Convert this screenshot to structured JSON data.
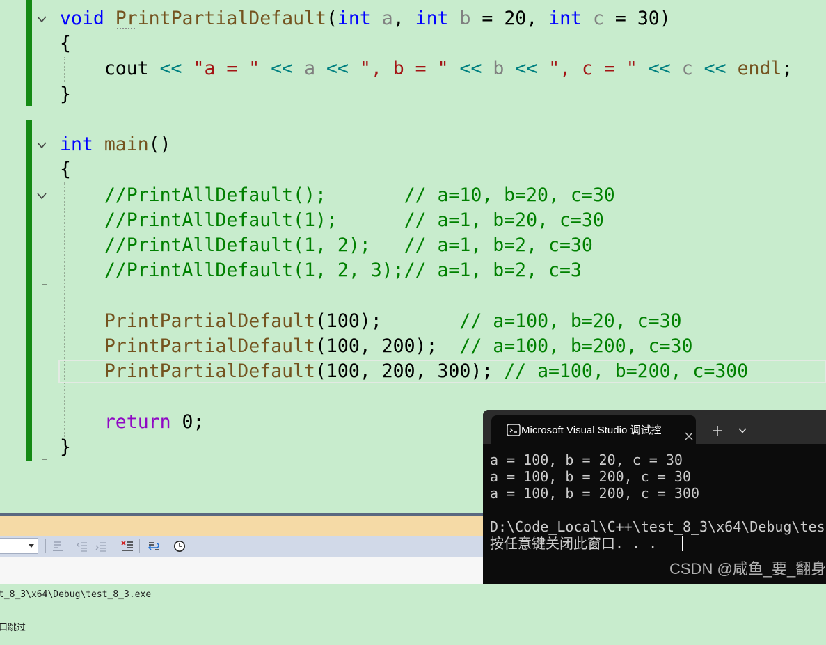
{
  "colors": {
    "editor_bg": "#C8ECCD",
    "change_bar": "#148A14",
    "terminal_bg": "#0C0C0C",
    "terminal_text": "#CCCCCC",
    "tabbar_bg": "#2C2C2C",
    "panel_tabstrip": "#F5DAA6",
    "panel_toolbar": "#D1D9E8",
    "panel_border": "#5A6880"
  },
  "editor": {
    "lines": [
      {
        "tokens": [
          [
            "void",
            "#0000FF"
          ],
          [
            " ",
            "#000000"
          ],
          [
            "PrintPartialDefault",
            "#74531F"
          ],
          [
            "(",
            "#000000"
          ],
          [
            "int",
            "#0000FF"
          ],
          [
            " ",
            "#000000"
          ],
          [
            "a",
            "#808080"
          ],
          [
            ", ",
            "#000000"
          ],
          [
            "int",
            "#0000FF"
          ],
          [
            " ",
            "#000000"
          ],
          [
            "b",
            "#808080"
          ],
          [
            " = 20, ",
            "#000000"
          ],
          [
            "int",
            "#0000FF"
          ],
          [
            " ",
            "#000000"
          ],
          [
            "c",
            "#808080"
          ],
          [
            " = 30)",
            "#000000"
          ]
        ]
      },
      {
        "tokens": [
          [
            "{",
            "#000000"
          ]
        ]
      },
      {
        "tokens": [
          [
            "    cout ",
            "#000000"
          ],
          [
            "<<",
            "#008080"
          ],
          [
            " ",
            "#000000"
          ],
          [
            "\"a = \"",
            "#A31515"
          ],
          [
            " ",
            "#000000"
          ],
          [
            "<<",
            "#008080"
          ],
          [
            " ",
            "#000000"
          ],
          [
            "a",
            "#808080"
          ],
          [
            " ",
            "#000000"
          ],
          [
            "<<",
            "#008080"
          ],
          [
            " ",
            "#000000"
          ],
          [
            "\", b = \"",
            "#A31515"
          ],
          [
            " ",
            "#000000"
          ],
          [
            "<<",
            "#008080"
          ],
          [
            " ",
            "#000000"
          ],
          [
            "b",
            "#808080"
          ],
          [
            " ",
            "#000000"
          ],
          [
            "<<",
            "#008080"
          ],
          [
            " ",
            "#000000"
          ],
          [
            "\", c = \"",
            "#A31515"
          ],
          [
            " ",
            "#000000"
          ],
          [
            "<<",
            "#008080"
          ],
          [
            " ",
            "#000000"
          ],
          [
            "c",
            "#808080"
          ],
          [
            " ",
            "#000000"
          ],
          [
            "<<",
            "#008080"
          ],
          [
            " ",
            "#000000"
          ],
          [
            "endl",
            "#74531F"
          ],
          [
            ";",
            "#000000"
          ]
        ]
      },
      {
        "tokens": [
          [
            "}",
            "#000000"
          ]
        ]
      },
      {
        "tokens": []
      },
      {
        "tokens": [
          [
            "int",
            "#0000FF"
          ],
          [
            " ",
            "#000000"
          ],
          [
            "main",
            "#74531F"
          ],
          [
            "()",
            "#000000"
          ]
        ]
      },
      {
        "tokens": [
          [
            "{",
            "#000000"
          ]
        ]
      },
      {
        "tokens": [
          [
            "    ",
            "#000000"
          ],
          [
            "//PrintAllDefault();       // a=10, b=20, c=30",
            "#008000"
          ]
        ]
      },
      {
        "tokens": [
          [
            "    ",
            "#000000"
          ],
          [
            "//PrintAllDefault(1);      // a=1, b=20, c=30",
            "#008000"
          ]
        ]
      },
      {
        "tokens": [
          [
            "    ",
            "#000000"
          ],
          [
            "//PrintAllDefault(1, 2);   // a=1, b=2, c=30",
            "#008000"
          ]
        ]
      },
      {
        "tokens": [
          [
            "    ",
            "#000000"
          ],
          [
            "//PrintAllDefault(1, 2, 3);// a=1, b=2, c=3",
            "#008000"
          ]
        ]
      },
      {
        "tokens": []
      },
      {
        "tokens": [
          [
            "    ",
            "#000000"
          ],
          [
            "PrintPartialDefault",
            "#74531F"
          ],
          [
            "(100);       ",
            "#000000"
          ],
          [
            "// a=100, b=20, c=30",
            "#008000"
          ]
        ]
      },
      {
        "tokens": [
          [
            "    ",
            "#000000"
          ],
          [
            "PrintPartialDefault",
            "#74531F"
          ],
          [
            "(100, 200);  ",
            "#000000"
          ],
          [
            "// a=100, b=200, c=30",
            "#008000"
          ]
        ]
      },
      {
        "tokens": [
          [
            "    ",
            "#000000"
          ],
          [
            "PrintPartialDefault",
            "#74531F"
          ],
          [
            "(100, 200, 300); ",
            "#000000"
          ],
          [
            "// a=100, b=200, c=300",
            "#008000"
          ]
        ]
      },
      {
        "tokens": []
      },
      {
        "tokens": [
          [
            "    ",
            "#000000"
          ],
          [
            "return",
            "#8F08C4"
          ],
          [
            " 0;",
            "#000000"
          ]
        ]
      },
      {
        "tokens": [
          [
            "}",
            "#000000"
          ]
        ]
      }
    ]
  },
  "terminal": {
    "icon": "console-icon",
    "tab_title": "Microsoft Visual Studio 调试控",
    "close_icon": "close-icon",
    "new_tab_icon": "plus-icon",
    "dropdown_icon": "chevron-down-icon",
    "lines": [
      "a = 100, b = 20, c = 30",
      "a = 100, b = 200, c = 30",
      "a = 100, b = 200, c = 300",
      "",
      "D:\\Code_Local\\C++\\test_8_3\\x64\\Debug\\tes",
      "按任意键关闭此窗口. . ."
    ]
  },
  "output": {
    "toolbar_icons": [
      "find-message-icon",
      "previous-message-icon",
      "next-message-icon",
      "clear-all-icon",
      "word-wrap-icon",
      "clock-icon"
    ],
    "lines": [
      "t_8_3\\x64\\Debug\\test_8_3.exe",
      "口跳过"
    ]
  },
  "watermark": "CSDN @咸鱼_要_翻身"
}
